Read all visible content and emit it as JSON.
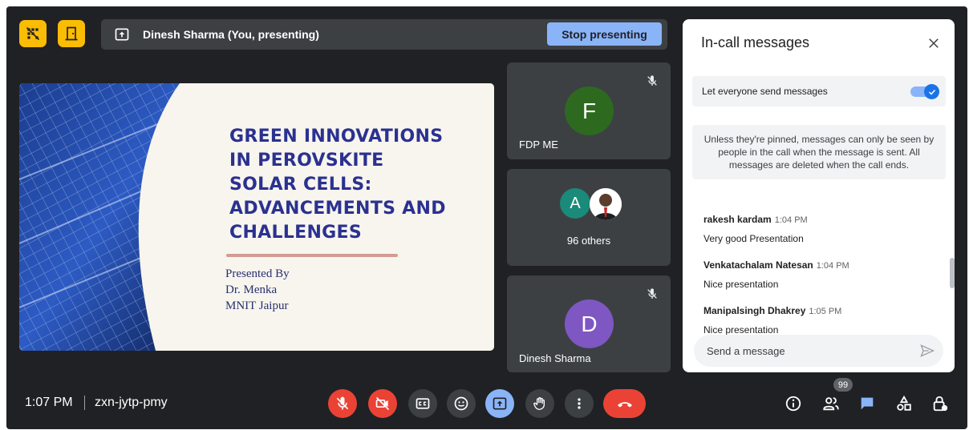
{
  "presentation_bar": {
    "presenter_text": "Dinesh Sharma (You, presenting)",
    "stop_label": "Stop presenting"
  },
  "slide": {
    "title_lines": [
      "GREEN INNOVATIONS",
      "IN PEROVSKITE",
      "SOLAR CELLS:",
      "ADVANCEMENTS AND",
      "CHALLENGES"
    ],
    "byline": [
      "Presented By",
      "Dr. Menka",
      "MNIT Jaipur"
    ]
  },
  "tiles": [
    {
      "name": "FDP ME",
      "initial": "F",
      "avatar_color": "#2d6a1f",
      "muted": true
    },
    {
      "name": "96 others",
      "initial": "A",
      "avatar_color": "#1a8a7a"
    },
    {
      "name": "Dinesh Sharma",
      "initial": "D",
      "avatar_color": "#7e57c2",
      "muted": true
    }
  ],
  "chat": {
    "title": "In-call messages",
    "toggle_label": "Let everyone send messages",
    "toggle_on": true,
    "notice": "Unless they're pinned, messages can only be seen by people in the call when the message is sent. All messages are deleted when the call ends.",
    "messages": [
      {
        "sender": "rakesh kardam",
        "time": "1:04 PM",
        "text": "Very good Presentation"
      },
      {
        "sender": "Venkatachalam Natesan",
        "time": "1:04 PM",
        "text": "Nice presentation"
      },
      {
        "sender": "Manipalsingh Dhakrey",
        "time": "1:05 PM",
        "text": "Nice presentation"
      }
    ],
    "input_placeholder": "Send a message"
  },
  "bottom": {
    "time": "1:07 PM",
    "meeting_code": "zxn-jytp-pmy",
    "participant_count": "99"
  },
  "colors": {
    "accent": "#8ab4f8",
    "danger": "#ea4335",
    "end_call": "#ea4335",
    "warning_buttons": "#fbbc04"
  }
}
